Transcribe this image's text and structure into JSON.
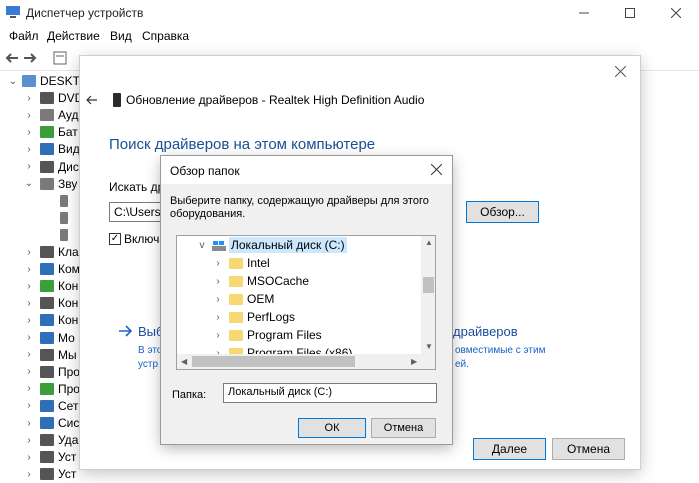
{
  "device_manager": {
    "title": "Диспетчер устройств",
    "menu": [
      "Файл",
      "Действие",
      "Вид",
      "Справка"
    ],
    "tree": [
      {
        "label": "DESKTO",
        "chev": "v",
        "color": "#5a8fd0"
      },
      {
        "label": "DVD",
        "chev": ">",
        "color": "#555555"
      },
      {
        "label": "Ауд",
        "chev": ">",
        "color": "#7a7a7a"
      },
      {
        "label": "Бат",
        "chev": ">",
        "color": "#3b9e3b"
      },
      {
        "label": "Вид",
        "chev": ">",
        "color": "#2f6fb8"
      },
      {
        "label": "Дис",
        "chev": ">",
        "color": "#555555"
      },
      {
        "label": "Зву",
        "chev": "v",
        "color": "#7a7a7a"
      },
      {
        "label": "",
        "chev": "",
        "color": "#7a7a7a"
      },
      {
        "label": "",
        "chev": "",
        "color": "#7a7a7a"
      },
      {
        "label": "",
        "chev": "",
        "color": "#7a7a7a"
      },
      {
        "label": "Кла",
        "chev": ">",
        "color": "#555555"
      },
      {
        "label": "Ком",
        "chev": ">",
        "color": "#2f6fb8"
      },
      {
        "label": "Кон",
        "chev": ">",
        "color": "#3b9e3b"
      },
      {
        "label": "Кон",
        "chev": ">",
        "color": "#555555"
      },
      {
        "label": "Кон",
        "chev": ">",
        "color": "#2f6fb8"
      },
      {
        "label": "Мо",
        "chev": ">",
        "color": "#2f6fb8"
      },
      {
        "label": "Мы",
        "chev": ">",
        "color": "#555555"
      },
      {
        "label": "Про",
        "chev": ">",
        "color": "#555555"
      },
      {
        "label": "Про",
        "chev": ">",
        "color": "#3b9e3b"
      },
      {
        "label": "Сет",
        "chev": ">",
        "color": "#2f6fb8"
      },
      {
        "label": "Сис",
        "chev": ">",
        "color": "#2f6fb8"
      },
      {
        "label": "Уда",
        "chev": ">",
        "color": "#555555"
      },
      {
        "label": "Уст",
        "chev": ">",
        "color": "#555555"
      },
      {
        "label": "Уст",
        "chev": ">",
        "color": "#555555"
      }
    ]
  },
  "update_dialog": {
    "title": "Обновление драйверов - Realtek High Definition Audio",
    "heading": "Поиск драйверов на этом компьютере",
    "search_label": "Искать дра",
    "path_value": "C:\\Users\\",
    "browse_button": "Обзор...",
    "include_checked": "✓",
    "include_label": "Включа",
    "pick_main": "Выб",
    "pick_tail": "драйверов",
    "pick_sub1": "В это",
    "pick_sub2": "устр",
    "pick_sub1_tail": "овместимые с этим",
    "pick_sub2_tail": "ей.",
    "next_button": "Далее",
    "cancel_button": "Отмена"
  },
  "browse_dialog": {
    "title": "Обзор папок",
    "description_line1": "Выберите папку, содержащую драйверы для этого",
    "description_line2": "оборудования.",
    "root_label": "Локальный диск (C:)",
    "folders": [
      "Intel",
      "MSOCache",
      "OEM",
      "PerfLogs",
      "Program Files",
      "Program Files (x86)"
    ],
    "folder_label": "Папка:",
    "folder_value": "Локальный диск (C:)",
    "ok_button": "ОК",
    "cancel_button": "Отмена"
  },
  "colors": {
    "accent": "#0078d7",
    "heading": "#1c4f95",
    "link": "#1a62c7",
    "folder": "#f8d775",
    "selection": "#cce8ff"
  }
}
